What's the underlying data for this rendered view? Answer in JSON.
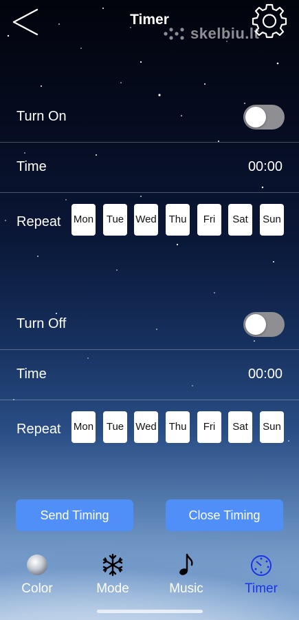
{
  "header": {
    "title": "Timer",
    "back_icon": "chevron-left-icon",
    "settings_icon": "gear-icon"
  },
  "watermark": {
    "text": "skelbiu.lt"
  },
  "turn_on": {
    "label": "Turn On",
    "enabled": false,
    "time_label": "Time",
    "time_value": "00:00",
    "repeat_label": "Repeat",
    "days": [
      "Mon",
      "Tue",
      "Wed",
      "Thu",
      "Fri",
      "Sat",
      "Sun"
    ]
  },
  "turn_off": {
    "label": "Turn Off",
    "enabled": false,
    "time_label": "Time",
    "time_value": "00:00",
    "repeat_label": "Repeat",
    "days": [
      "Mon",
      "Tue",
      "Wed",
      "Thu",
      "Fri",
      "Sat",
      "Sun"
    ]
  },
  "actions": {
    "send": "Send Timing",
    "close": "Close Timing"
  },
  "tabs": [
    {
      "label": "Color",
      "icon": "color-disc-icon",
      "active": false
    },
    {
      "label": "Mode",
      "icon": "snowflake-icon",
      "active": false
    },
    {
      "label": "Music",
      "icon": "music-note-icon",
      "active": false
    },
    {
      "label": "Timer",
      "icon": "timer-dial-icon",
      "active": true
    }
  ],
  "colors": {
    "accent_button": "#4f8ff7",
    "active_tab": "#1a34e6",
    "toggle_off": "#8e8e93"
  }
}
